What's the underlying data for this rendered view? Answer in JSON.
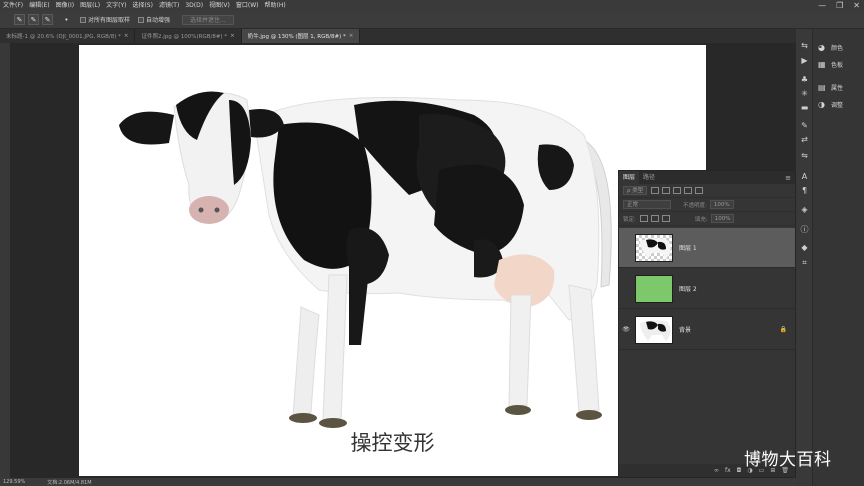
{
  "menu": [
    "文件(F)",
    "编辑(E)",
    "图像(I)",
    "图层(L)",
    "文字(Y)",
    "选择(S)",
    "滤镜(T)",
    "3D(D)",
    "视图(V)",
    "窗口(W)",
    "帮助(H)"
  ],
  "window_buttons": [
    "—",
    "❐",
    "✕"
  ],
  "options": {
    "sample_all_label": "对所有图层取样",
    "auto_enhance_label": "自动增强",
    "select_subject_label": "选择并遮住..."
  },
  "tabs": [
    {
      "label": "未标题-1 @ 20.6% (DJI_0001.JPG, RGB/8) *",
      "active": false
    },
    {
      "label": "证件照2.jpg @ 100%(RGB/8#) *",
      "active": false
    },
    {
      "label": "奶牛.jpg @ 130% (图层 1, RGB/8#) *",
      "active": true
    }
  ],
  "subtitle": "操控变形",
  "status": {
    "zoom": "129.59%",
    "doc": "文档:2.06M/4.81M"
  },
  "mini_panels": [
    {
      "icon": "palette-icon",
      "glyph": "◕",
      "label": "颜色"
    },
    {
      "icon": "swatches-icon",
      "glyph": "▦",
      "label": "色板"
    },
    {
      "icon": "properties-icon",
      "glyph": "▤",
      "label": "属性"
    },
    {
      "icon": "adjustments-icon",
      "glyph": "◑",
      "label": "调整"
    }
  ],
  "layers_panel": {
    "tabs": [
      "图层",
      "路径"
    ],
    "filter_kind": "ρ 类型",
    "blend_mode": "正常",
    "opacity_label": "不透明度:",
    "opacity_value": "100%",
    "lock_label": "锁定:",
    "fill_label": "填充:",
    "fill_value": "100%",
    "layers": [
      {
        "name": "图层 1",
        "selected": true,
        "visible": false,
        "thumb": "cow-transparent"
      },
      {
        "name": "图层 2",
        "selected": false,
        "visible": false,
        "thumb": "green"
      },
      {
        "name": "背景",
        "selected": false,
        "visible": true,
        "thumb": "cow",
        "locked": true
      }
    ],
    "colors": {
      "green_layer": "#7cc86b"
    }
  },
  "watermark": "博物大百科"
}
